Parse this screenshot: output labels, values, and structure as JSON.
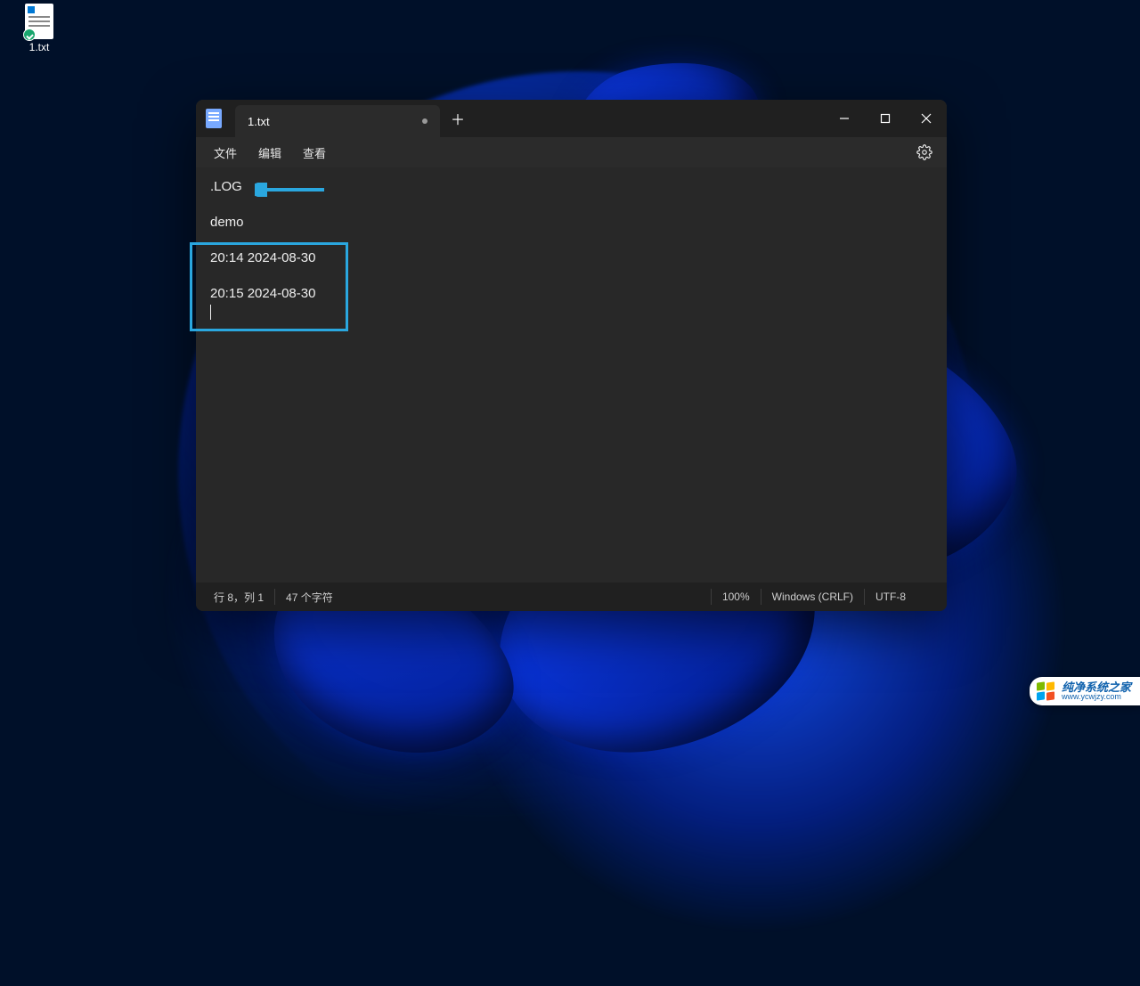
{
  "desktop": {
    "file_label": "1.txt"
  },
  "window": {
    "tab_title": "1.txt",
    "menus": {
      "file": "文件",
      "edit": "编辑",
      "view": "查看"
    },
    "content": {
      "l1": ".LOG",
      "l2": "",
      "l3": "demo",
      "l4": "",
      "l5": "20:14 2024-08-30",
      "l6": "",
      "l7": "20:15 2024-08-30"
    },
    "status": {
      "position": "行 8，列 1",
      "chars": "47 个字符",
      "zoom": "100%",
      "line_ending": "Windows (CRLF)",
      "encoding": "UTF-8"
    }
  },
  "watermark": {
    "title": "纯净系统之家",
    "url": "www.ycwjzy.com"
  }
}
